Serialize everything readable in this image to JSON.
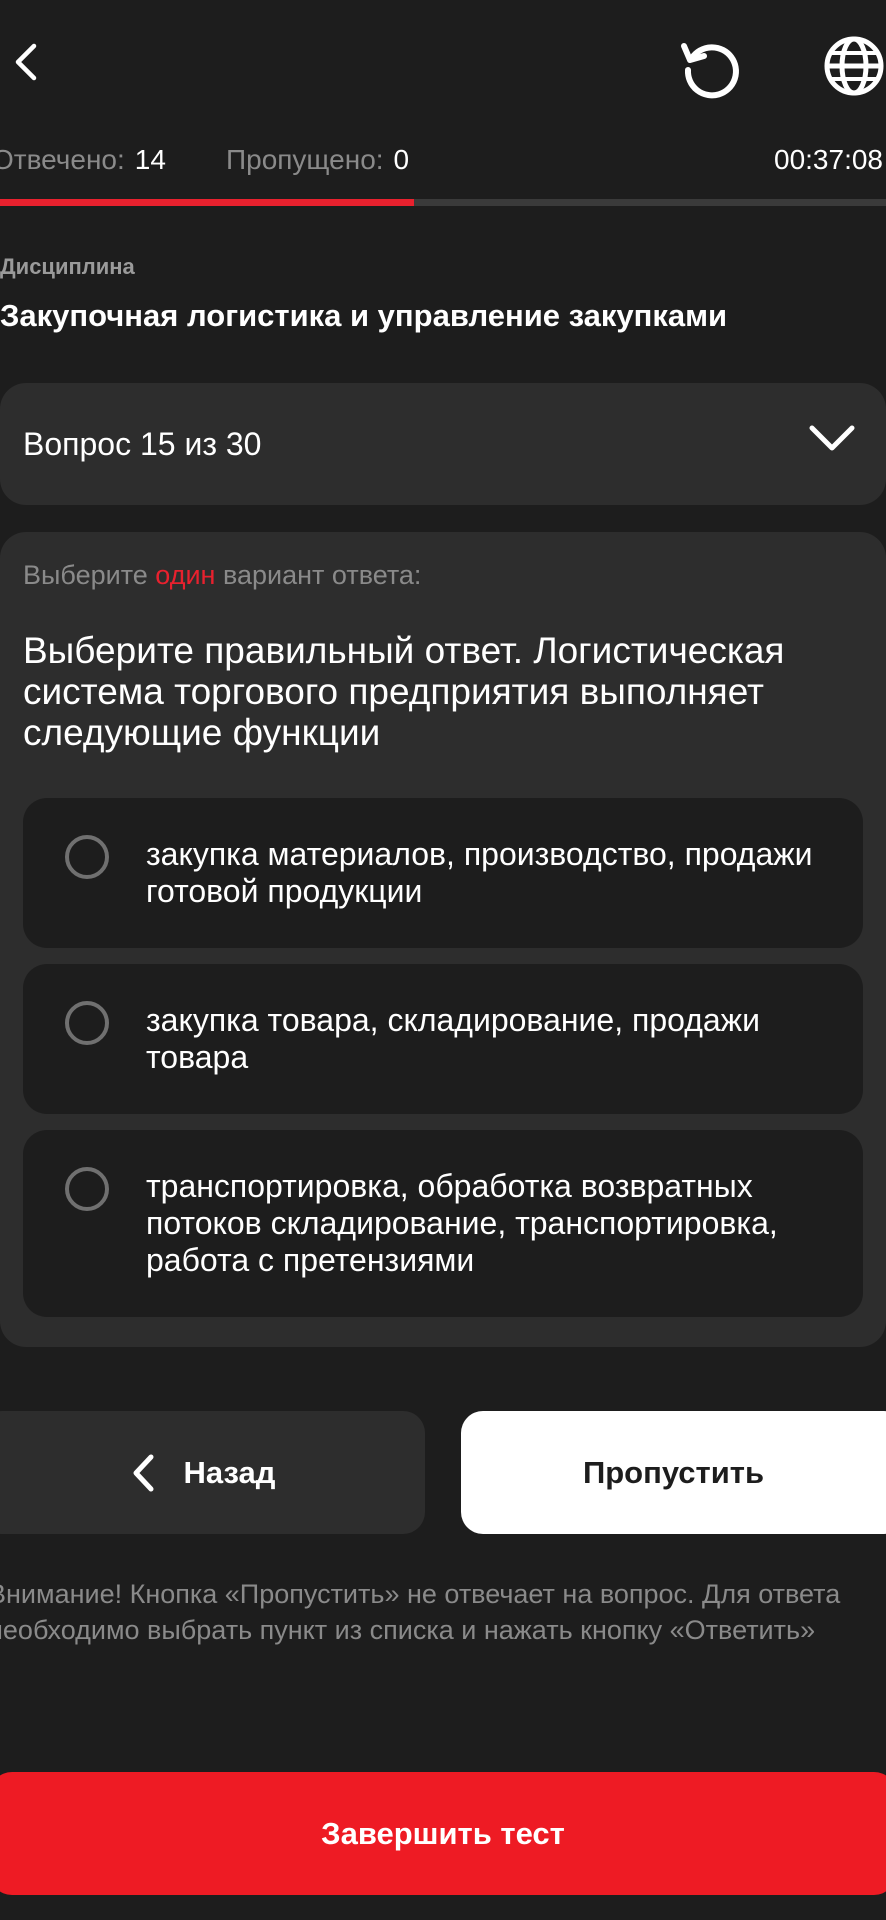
{
  "header": {
    "back_icon": "chevron-left-icon",
    "restart_icon": "restart-icon",
    "language_icon": "globe-icon"
  },
  "stats": {
    "answered_label": "Отвечено:",
    "answered_value": "14",
    "skipped_label": "Пропущено:",
    "skipped_value": "0",
    "timer": "00:37:08"
  },
  "progress": {
    "fraction": 0.467,
    "accent": "#e8212e"
  },
  "discipline": {
    "label": "Дисциплина",
    "title": "Закупочная логистика и управление закупками"
  },
  "question_selector": {
    "label": "Вопрос 15 из 30",
    "icon": "chevron-down-icon"
  },
  "question": {
    "hint_prefix": "Выберите ",
    "hint_accent": "один",
    "hint_suffix": " вариант ответа:",
    "text": "Выберите правильный ответ. Логистическая система торгового предприятия выполняет следующие функции",
    "options": [
      {
        "label": "закупка материалов, производство, продажи готовой продукции",
        "selected": false
      },
      {
        "label": "закупка товара, складирование, продажи товара",
        "selected": false
      },
      {
        "label": "транспортировка, обработка возвратных потоков складирование, транспортировка, работа с претензиями",
        "selected": false
      }
    ]
  },
  "actions": {
    "back_label": "Назад",
    "skip_label": "Пропустить",
    "finish_label": "Завершить тест"
  },
  "warning": "Внимание! Кнопка «Пропустить» не отвечает на вопрос. Для ответа необходимо выбрать пункт из списка и нажать кнопку «Ответить»",
  "colors": {
    "background": "#1d1d1d",
    "card": "#2d2d2d",
    "accent_red": "#ee1b24",
    "muted_text": "#8a8a8a"
  }
}
